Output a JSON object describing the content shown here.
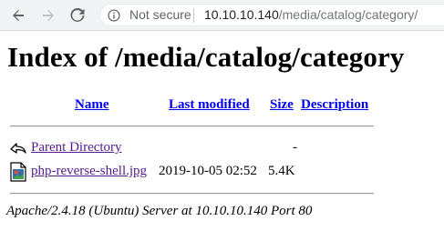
{
  "browser": {
    "security_label": "Not secure",
    "url_host": "10.10.10.140",
    "url_path": "/media/catalog/category/"
  },
  "page": {
    "title": "Index of /media/catalog/category",
    "columns": {
      "name": "Name",
      "last_modified": "Last modified",
      "size": "Size",
      "description": "Description"
    },
    "rows": [
      {
        "icon": "back-arrow-icon",
        "name": "Parent Directory",
        "last_modified": "",
        "size": "-",
        "description": ""
      },
      {
        "icon": "image-file-icon",
        "name": "php-reverse-shell.jpg",
        "last_modified": "2019-10-05 02:52",
        "size": "5.4K",
        "description": ""
      }
    ],
    "footer": "Apache/2.4.18 (Ubuntu) Server at 10.10.10.140 Port 80"
  },
  "colors": {
    "link_visited": "#551a8b",
    "link": "#0000ee",
    "toolbar_bg": "#f1f3f4"
  }
}
